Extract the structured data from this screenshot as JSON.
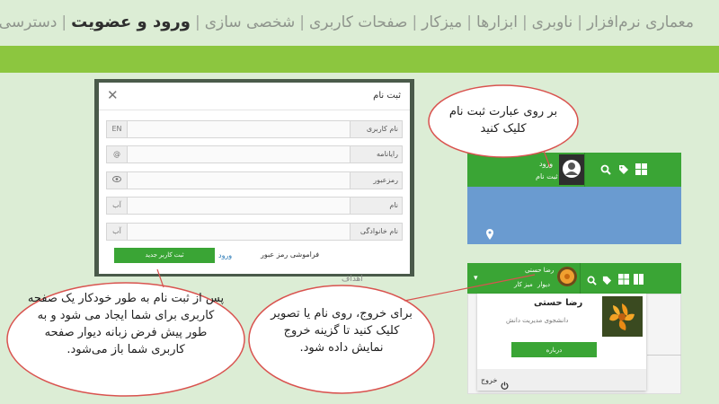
{
  "nav": {
    "items": [
      "معماری نرم‌افزار",
      "ناوبری",
      "ابزارها",
      "میزکار",
      "صفحات کاربری",
      "شخصی سازی",
      "ورود و عضویت",
      "دسترسی‌ها"
    ],
    "active_index": 6
  },
  "colors": {
    "green": "#3aa535",
    "lime": "#8cc63f",
    "blue": "#6a9bd0",
    "bg": "#dcedd5",
    "bubble_stroke": "#d9534f"
  },
  "modal": {
    "title": "ثبت نام",
    "fields": [
      {
        "label": "نام کاربری",
        "suffix": "EN"
      },
      {
        "label": "رایانامه",
        "suffix": "@"
      },
      {
        "label": "رمزعبور",
        "suffix": "eye-icon"
      },
      {
        "label": "نام",
        "suffix": "آ‌ب"
      },
      {
        "label": "نام خانوادگی",
        "suffix": "آ‌ب"
      }
    ],
    "register_button": "ثبت کاربر جدید",
    "login_link": "ورود",
    "forgot_link": "فراموشی رمز عبور"
  },
  "panel1": {
    "login": "ورود",
    "signup": "ثبت نام"
  },
  "panel2": {
    "user_name": "رضا حستی",
    "wall": "دیوار",
    "desk": "میز کار",
    "card_name": "رضا حستی",
    "card_role": "دانشجوی مدیریت دانش",
    "about_button": "درباره",
    "logout": "خروج"
  },
  "callouts": {
    "top": "بر روی عبارت ثبت نام کلیک کنید",
    "left": "پس از ثبت نام به طور خودکار یک صفحه کاربری برای شما ایجاد می شود و به طور پیش فرض زبانه دیوار صفحه کاربری شما باز می‌شود.",
    "right": "برای خروج، روی نام یا تصویر کلیک کنید تا گزینه خروج نمایش داده شود."
  },
  "page_peek": "اهداف"
}
